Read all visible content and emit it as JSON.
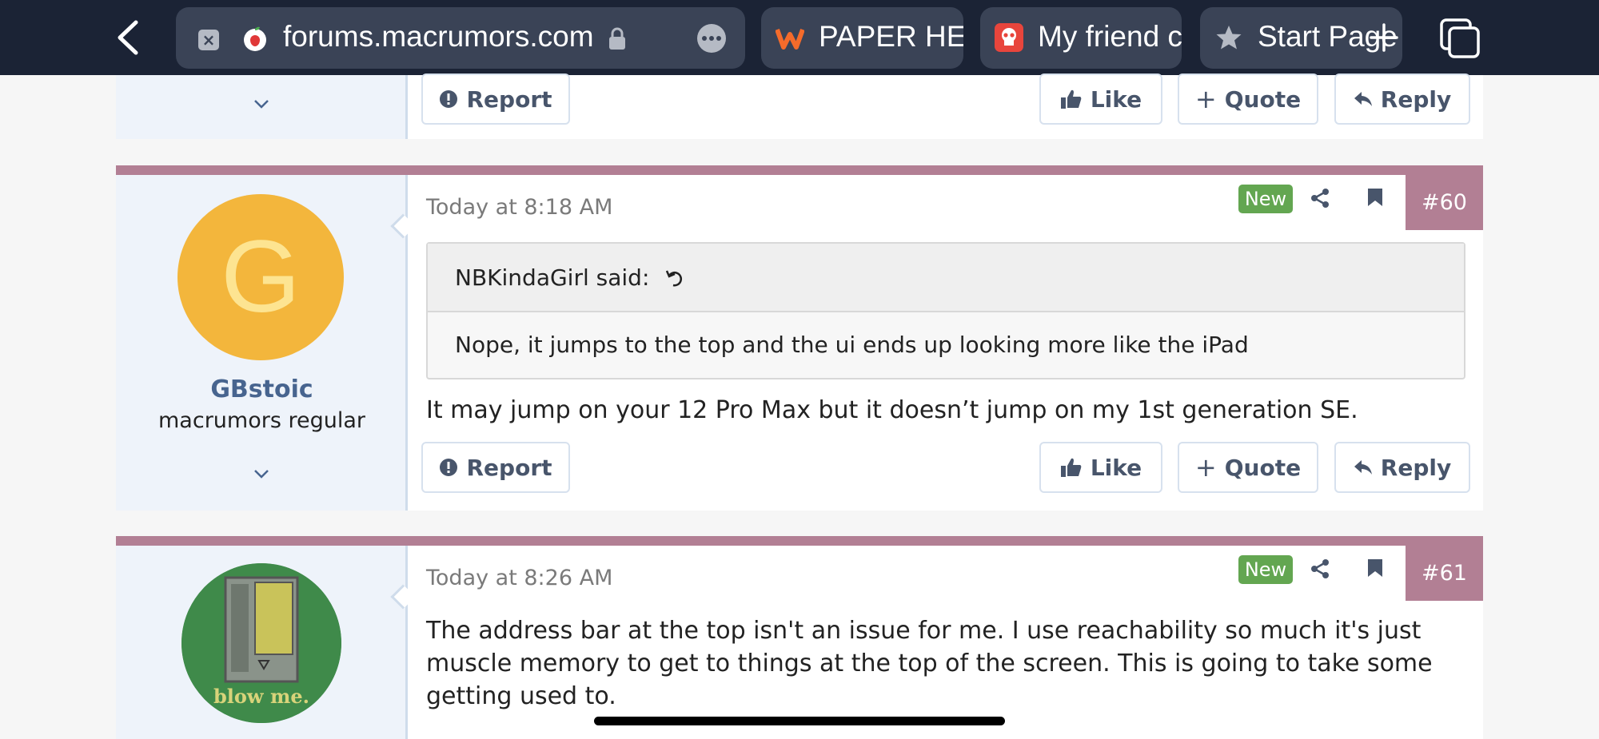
{
  "browser": {
    "url": "forums.macrumors.com",
    "tabs": [
      {
        "label": "PAPER HE/",
        "icon": "w-brand-icon",
        "color": "#f46b2b"
      },
      {
        "label": "My friend c",
        "icon": "skull-icon",
        "color": "#e8453c"
      },
      {
        "label": "Start Page",
        "icon": "star-icon",
        "color": "#b5bac4"
      }
    ]
  },
  "top_post": {
    "actions": {
      "report": "Report",
      "like": "Like",
      "quote": "Quote",
      "reply": "Reply"
    }
  },
  "posts": [
    {
      "number": "#60",
      "timestamp": "Today at 8:18 AM",
      "badge": "New",
      "author": {
        "avatar_letter": "G",
        "name": "GBstoic",
        "title": "macrumors regular",
        "avatar_color": "#f3b63c"
      },
      "quote": {
        "author_line": "NBKindaGirl said:",
        "text": "Nope, it jumps to the top and the ui ends up looking more like the iPad"
      },
      "body": "It may jump on your 12 Pro Max but it doesn’t jump on my 1st generation SE.",
      "actions": {
        "report": "Report",
        "like": "Like",
        "quote": "Quote",
        "reply": "Reply"
      }
    },
    {
      "number": "#61",
      "timestamp": "Today at 8:26 AM",
      "badge": "New",
      "author": {
        "avatar_caption": "blow me."
      },
      "body": "The address bar at the top isn't an issue for me. I use reachability so much it's just muscle memory to get to things at the top of the screen. This is going to take some getting used to."
    }
  ],
  "colors": {
    "stripe": "#b27f94",
    "new_badge": "#63a651",
    "topbar": "#1b2335",
    "username": "#47648f"
  }
}
